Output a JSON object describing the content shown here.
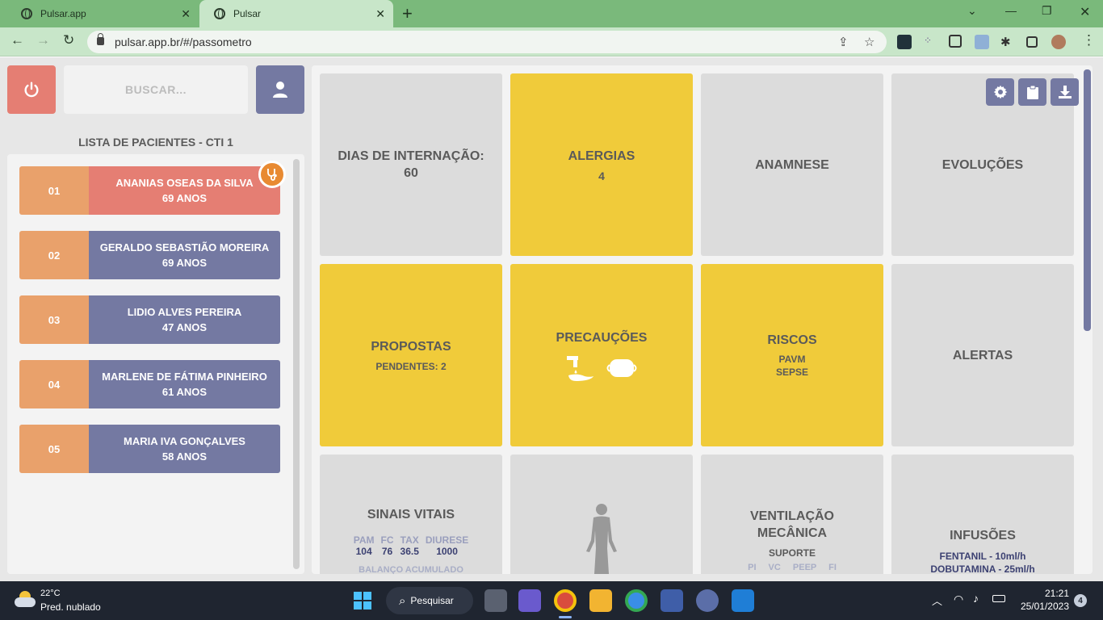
{
  "browser": {
    "tabs": [
      {
        "title": "Pulsar.app",
        "active": false
      },
      {
        "title": "Pulsar",
        "active": true
      }
    ],
    "url": "pulsar.app.br/#/passometro"
  },
  "sidebar": {
    "search_placeholder": "BUSCAR...",
    "list_title": "LISTA DE PACIENTES - CTI 1",
    "patients": [
      {
        "leito": "01",
        "name": "ANANIAS OSEAS DA SILVA",
        "age": "69 ANOS",
        "selected": true
      },
      {
        "leito": "02",
        "name": "GERALDO SEBASTIÃO MOREIRA",
        "age": "69 ANOS",
        "selected": false
      },
      {
        "leito": "03",
        "name": "LIDIO ALVES PEREIRA",
        "age": "47 ANOS",
        "selected": false
      },
      {
        "leito": "04",
        "name": "MARLENE DE FÁTIMA PINHEIRO",
        "age": "61 ANOS",
        "selected": false
      },
      {
        "leito": "05",
        "name": "MARIA IVA GONÇALVES",
        "age": "58 ANOS",
        "selected": false
      }
    ]
  },
  "dashboard": {
    "dias": {
      "title": "DIAS DE INTERNAÇÃO:",
      "value": "60"
    },
    "alergias": {
      "title": "ALERGIAS",
      "value": "4"
    },
    "anamnese": {
      "title": "ANAMNESE"
    },
    "evolucoes": {
      "title": "EVOLUÇÕES"
    },
    "propostas": {
      "title": "PROPOSTAS",
      "sub": "PENDENTES: 2"
    },
    "precaucoes": {
      "title": "PRECAUÇÕES"
    },
    "riscos": {
      "title": "RISCOS",
      "items": [
        "PAVM",
        "SEPSE"
      ]
    },
    "alertas": {
      "title": "ALERTAS"
    },
    "sinais": {
      "title": "SINAIS VITAIS",
      "headers": [
        "PAM",
        "FC",
        "TAX",
        "DIURESE"
      ],
      "values": [
        "104",
        "76",
        "36.5",
        "1000"
      ],
      "footer": "BALANÇO ACUMULADO"
    },
    "ventilacao": {
      "title_line1": "VENTILAÇÃO",
      "title_line2": "MECÂNICA",
      "sub": "SUPORTE",
      "footer": "PI VC PEEP FI"
    },
    "infusoes": {
      "title": "INFUSÕES",
      "items": [
        "FENTANIL - 10ml/h",
        "DOBUTAMINA - 25ml/h"
      ]
    }
  },
  "taskbar": {
    "weather_temp": "22°C",
    "weather_desc": "Pred. nublado",
    "search_label": "Pesquisar",
    "time": "21:21",
    "date": "25/01/2023",
    "notifications": "4"
  },
  "colors": {
    "yellow_tile": "#f0cb3a",
    "gray_tile": "#dcdcdc",
    "purple": "#7479a2",
    "salmon": "#e57e73",
    "orange": "#e9a16b"
  }
}
